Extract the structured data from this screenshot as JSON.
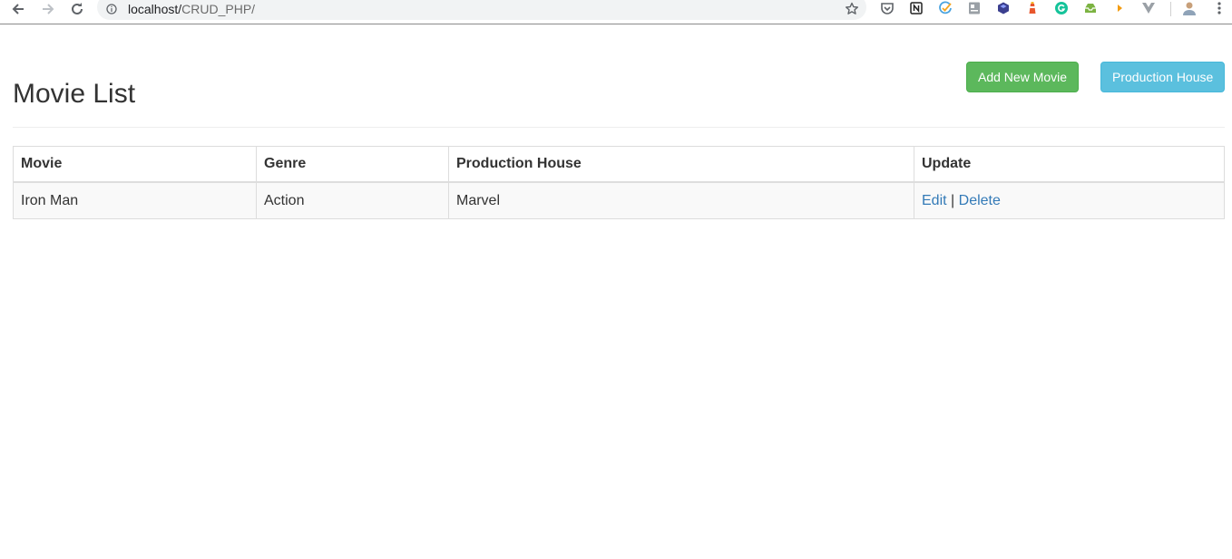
{
  "browser": {
    "url_host": "localhost/",
    "url_path": "CRUD_PHP/",
    "extensions": [
      "pocket-icon",
      "notion-icon",
      "todoist-check-icon",
      "doc-extension-icon",
      "cube-extension-icon",
      "lighthouse-icon",
      "grammarly-icon",
      "inbox-extension-icon",
      "arrow-extension-icon",
      "vue-devtools-icon"
    ]
  },
  "header": {
    "title": "Movie List",
    "add_button_label": "Add New Movie",
    "production_button_label": "Production House"
  },
  "table": {
    "columns": [
      "Movie",
      "Genre",
      "Production House",
      "Update"
    ],
    "rows": [
      {
        "movie": "Iron Man",
        "genre": "Action",
        "production_house": "Marvel",
        "edit_label": "Edit",
        "separator": "|",
        "delete_label": "Delete"
      }
    ]
  },
  "colors": {
    "success": "#5cb85c",
    "info": "#5bc0de",
    "link": "#337ab7"
  }
}
